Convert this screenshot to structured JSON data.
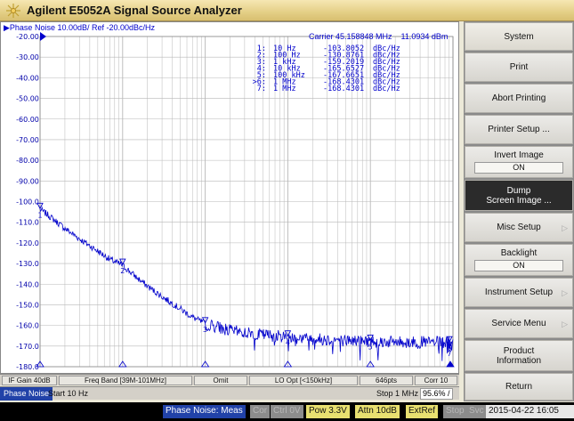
{
  "window": {
    "title": "Agilent E5052A Signal Source Analyzer"
  },
  "trace": {
    "title": "▶Phase Noise 10.00dB/ Ref -20.00dBc/Hz",
    "carrier_label": "Carrier 45.158848 MHz",
    "carrier_power": "11.0934 dBm"
  },
  "markers": [
    {
      "label": "1:",
      "freq": "10 Hz",
      "value": "-103.8052",
      "unit": "dBc/Hz"
    },
    {
      "label": "2:",
      "freq": "100 Hz",
      "value": "-130.8761",
      "unit": "dBc/Hz"
    },
    {
      "label": "3:",
      "freq": "1 kHz",
      "value": "-159.2019",
      "unit": "dBc/Hz"
    },
    {
      "label": "4:",
      "freq": "10 kHz",
      "value": "-165.6527",
      "unit": "dBc/Hz"
    },
    {
      "label": "5:",
      "freq": "100 kHz",
      "value": "-167.6651",
      "unit": "dBc/Hz"
    },
    {
      "label": ">6:",
      "freq": "1 MHz",
      "value": "-168.4301",
      "unit": "dBc/Hz"
    },
    {
      "label": "7:",
      "freq": "1 MHz",
      "value": "-168.4301",
      "unit": "dBc/Hz"
    }
  ],
  "chart_data": {
    "type": "line",
    "x_scale": "log",
    "xlim": [
      10,
      1000000
    ],
    "ylim": [
      -180,
      -20
    ],
    "y_ticks": [
      "-20.00",
      "-30.00",
      "-40.00",
      "-50.00",
      "-60.00",
      "-70.00",
      "-80.00",
      "-90.00",
      "-100.0",
      "-110.0",
      "-120.0",
      "-130.0",
      "-140.0",
      "-150.0",
      "-160.0",
      "-170.0",
      "-180.0"
    ],
    "series": [
      {
        "x": [
          10,
          12,
          15,
          20,
          30,
          50,
          70,
          100,
          150,
          200,
          300,
          500,
          700,
          1000,
          1500,
          2000,
          3000,
          5000,
          7000,
          10000,
          20000,
          50000,
          100000,
          200000,
          500000,
          1000000
        ],
        "y": [
          -103.8,
          -106,
          -109,
          -113,
          -118,
          -124,
          -128,
          -130.9,
          -137,
          -141,
          -146,
          -152,
          -156,
          -159.2,
          -161,
          -162.5,
          -163.5,
          -164.5,
          -165,
          -165.7,
          -166.5,
          -167.2,
          -167.7,
          -168,
          -168.2,
          -168.4
        ]
      }
    ],
    "markers": [
      {
        "n": "1",
        "x": 10,
        "y": -103.8052
      },
      {
        "n": "2",
        "x": 100,
        "y": -130.8761
      },
      {
        "n": "3",
        "x": 1000,
        "y": -159.2019
      },
      {
        "n": "4",
        "x": 10000,
        "y": -165.6527
      },
      {
        "n": "5",
        "x": 100000,
        "y": -167.6651
      },
      {
        "n": "6",
        "x": 1000000,
        "y": -168.4301
      },
      {
        "n": "7",
        "x": 1000000,
        "y": -168.4301
      }
    ],
    "xlabel": "",
    "ylabel": "",
    "grid": true,
    "colors": {
      "trace": "#0000cc",
      "grid": "#b8b8b8",
      "text": "#0000cc"
    }
  },
  "status_row": {
    "if_gain": "IF Gain 40dB",
    "freq_band": "Freq Band [39M-101MHz]",
    "omit": "Omit",
    "lo_opt": "LO Opt [<150kHz]",
    "points": "646pts",
    "corr": "Corr 10"
  },
  "sweep_row": {
    "mode": "Phase Noise",
    "start": "Start 10 Hz",
    "stop": "Stop 1 MHz",
    "percent": "95.6%",
    "slash": "/"
  },
  "bottom_bar": {
    "measure": "Phase Noise: Meas",
    "cor": "Cor",
    "ctrl": "Ctrl 0V",
    "pow": "Pow 3.3V",
    "attn": "Attn 10dB",
    "extref": "ExtRef",
    "stop": "Stop",
    "svc": "Svc",
    "datetime": "2015-04-22 16:05"
  },
  "menu": {
    "system": "System",
    "print": "Print",
    "abort": "Abort Printing",
    "printer_setup": "Printer Setup ...",
    "invert_image": "Invert Image",
    "invert_value": "ON",
    "dump": "Dump",
    "dump2": "Screen Image ...",
    "misc": "Misc Setup",
    "backlight": "Backlight",
    "backlight_value": "ON",
    "instrument": "Instrument Setup",
    "service": "Service Menu",
    "product": "Product",
    "product2": "Information",
    "return": "Return"
  }
}
